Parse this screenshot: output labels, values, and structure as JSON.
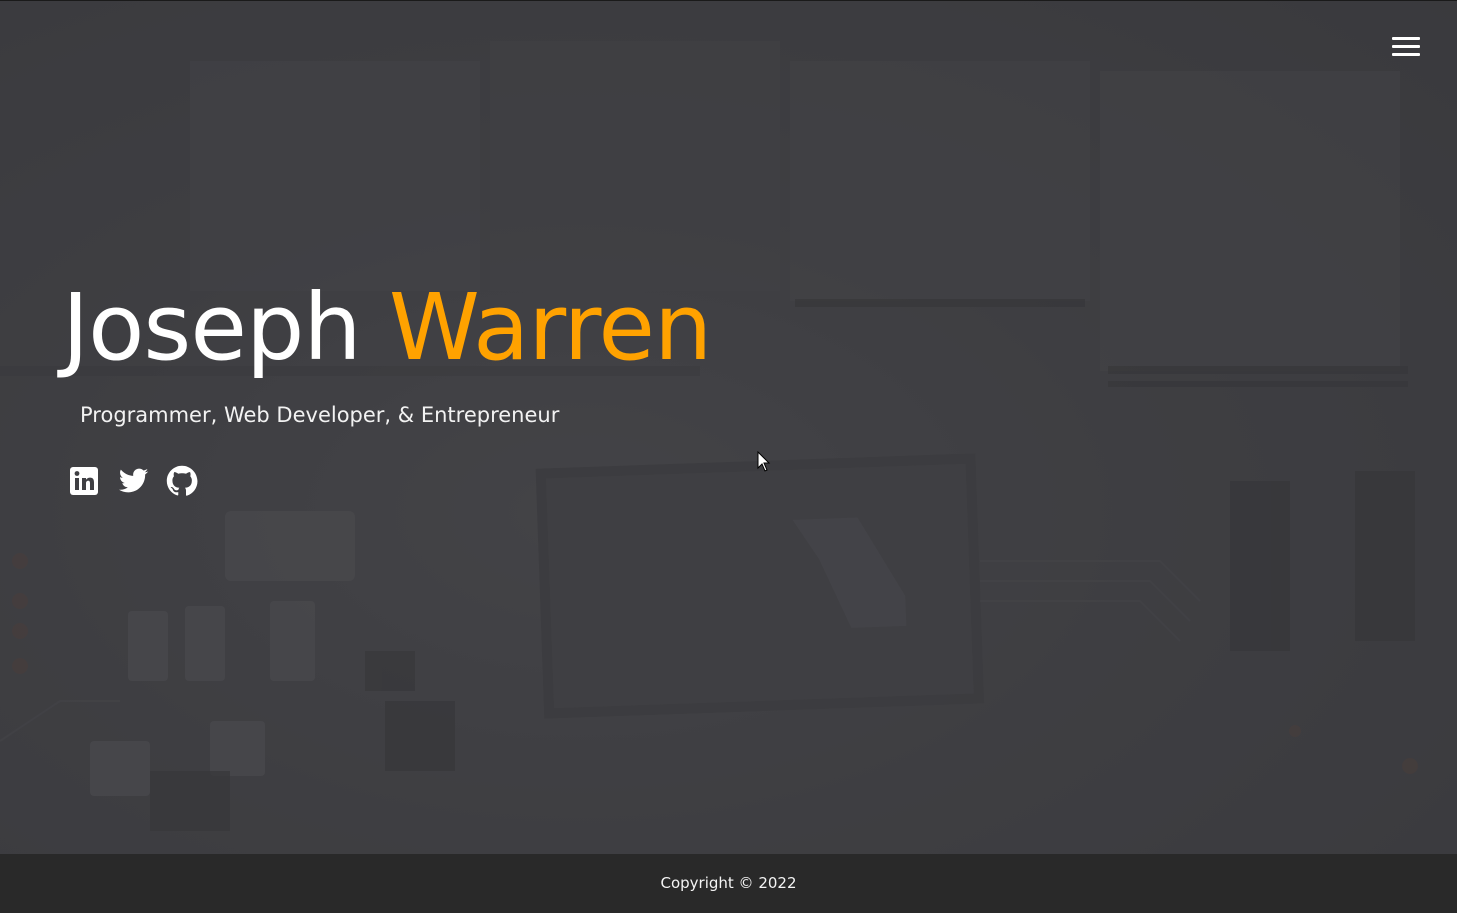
{
  "header": {
    "menu_icon": "hamburger-menu-icon"
  },
  "hero": {
    "first_name": "Joseph",
    "last_name": "Warren",
    "tagline": "Programmer, Web Developer, & Entrepreneur",
    "accent_color": "#ffa200",
    "background_image": "circuit-board photo (darkened)"
  },
  "social": [
    {
      "icon": "linkedin-icon"
    },
    {
      "icon": "twitter-icon"
    },
    {
      "icon": "github-icon"
    }
  ],
  "footer": {
    "copyright": "Copyright © 2022",
    "background": "#292929"
  }
}
